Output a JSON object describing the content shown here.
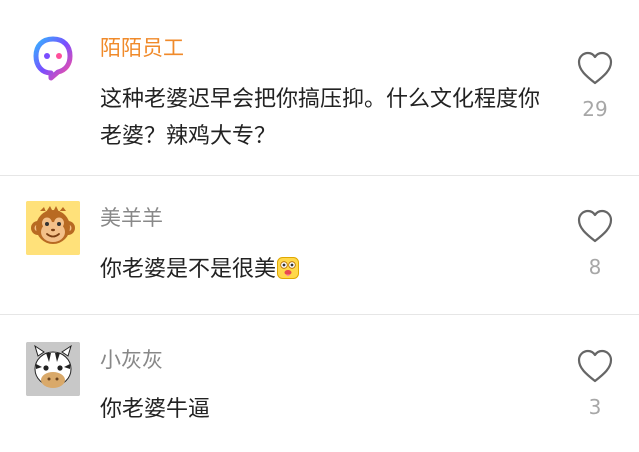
{
  "comments": [
    {
      "username": "陌陌员工",
      "text": "这种老婆迟早会把你搞压抑。什么文化程度你老婆？辣鸡大专？",
      "likes": "29",
      "avatar_icon": "momo-logo-icon"
    },
    {
      "username": "美羊羊",
      "text": "你老婆是不是很美",
      "emoji": "drooling-face-emoji",
      "likes": "8",
      "avatar_icon": "monkey-face-icon"
    },
    {
      "username": "小灰灰",
      "text": "你老婆牛逼",
      "likes": "3",
      "avatar_icon": "zebra-face-icon"
    }
  ],
  "colors": {
    "accent_username": "#f08a2a",
    "username": "#888888",
    "text": "#222222",
    "like_count": "#a7a7a7",
    "divider": "#e6e6e6"
  }
}
